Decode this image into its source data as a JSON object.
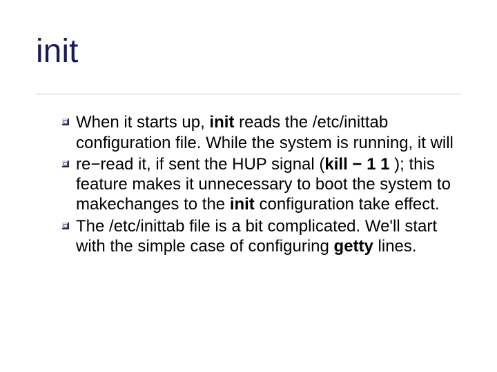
{
  "title": "init",
  "bullets": [
    {
      "runs": [
        {
          "t": "When it starts up, "
        },
        {
          "t": "init",
          "bold": true
        },
        {
          "t": " reads the /etc/inittab configuration file. While the system is running, it will"
        }
      ]
    },
    {
      "runs": [
        {
          "t": "re−read it, if sent the HUP signal ("
        },
        {
          "t": "kill − 1 1",
          "bold": true
        },
        {
          "t": " ); this feature makes it unnecessary to boot the system to makechanges to the "
        },
        {
          "t": "init",
          "bold": true
        },
        {
          "t": " configuration take effect."
        }
      ]
    },
    {
      "runs": [
        {
          "t": "The /etc/inittab file is a bit complicated. We'll start with the simple case of configuring "
        },
        {
          "t": "getty",
          "bold": true
        },
        {
          "t": " lines."
        }
      ]
    }
  ]
}
